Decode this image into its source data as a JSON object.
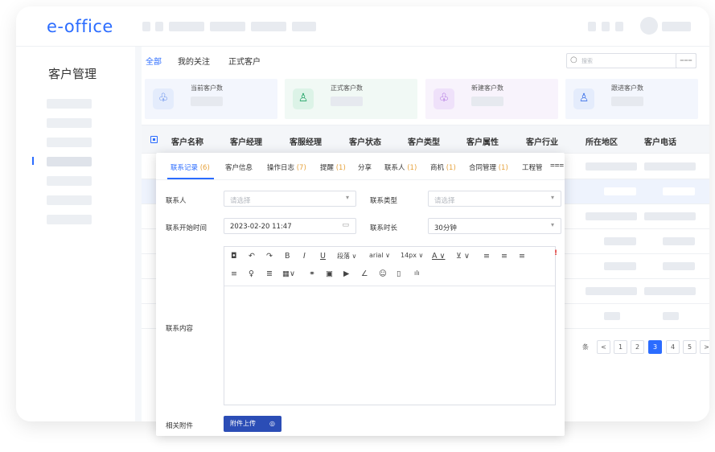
{
  "app": {
    "logo": "e-office"
  },
  "sidebar": {
    "title": "客户管理"
  },
  "tabs": [
    {
      "label": "全部",
      "active": true
    },
    {
      "label": "我的关注",
      "active": false
    },
    {
      "label": "正式客户",
      "active": false
    }
  ],
  "search": {
    "placeholder": "搜索",
    "icon": "search-icon",
    "filter_icon": "filter-icon",
    "filter_glyph": "⩶"
  },
  "cards": [
    {
      "label": "当前客户数",
      "icon": "customers-icon",
      "glyph": "♧",
      "bg": "#f3f6fd",
      "icon_bg": "#e4ecfc",
      "icon_color": "#3a6fe8"
    },
    {
      "label": "正式客户数",
      "icon": "formal-customer-icon",
      "glyph": "♙",
      "bg": "#f1f9f5",
      "icon_bg": "#dcf3e7",
      "icon_color": "#21a366"
    },
    {
      "label": "新建客户数",
      "icon": "new-customer-icon",
      "glyph": "♧",
      "bg": "#f8f3fc",
      "icon_bg": "#efe1fa",
      "icon_color": "#9b4fd8"
    },
    {
      "label": "跟进客户数",
      "icon": "follow-customer-icon",
      "glyph": "♙",
      "bg": "#f3f6fd",
      "icon_bg": "#e4ecfc",
      "icon_color": "#3a6fe8"
    }
  ],
  "table": {
    "headers": [
      "客户名称",
      "客户经理",
      "客服经理",
      "客户状态",
      "客户类型",
      "客户属性",
      "客户行业",
      "所在地区",
      "客户电话"
    ]
  },
  "pagination": {
    "prefix": "条",
    "pages": [
      "1",
      "2",
      "3",
      "4",
      "5"
    ],
    "active": "3",
    "prev": "<",
    "next": ">"
  },
  "modal": {
    "tabs": [
      {
        "label": "联系记录",
        "count": "(6)",
        "active": true
      },
      {
        "label": "客户信息",
        "count": "",
        "active": false
      },
      {
        "label": "操作日志",
        "count": "(7)",
        "active": false
      },
      {
        "label": "提醒",
        "count": "(1)",
        "active": false
      },
      {
        "label": "分享",
        "count": "",
        "active": false
      },
      {
        "label": "联系人",
        "count": "(1)",
        "active": false
      },
      {
        "label": "商机",
        "count": "(1)",
        "active": false
      },
      {
        "label": "合同管理",
        "count": "(1)",
        "active": false
      },
      {
        "label": "工程管",
        "count": "",
        "active": false
      }
    ],
    "more_glyph": "⩶",
    "form": {
      "contact_label": "联系人",
      "contact_placeholder": "请选择",
      "contact_type_label": "联系类型",
      "contact_type_placeholder": "请选择",
      "start_time_label": "联系开始时间",
      "start_time_value": "2023-02-20 11:47",
      "duration_label": "联系时长",
      "duration_value": "30分钟",
      "content_label": "联系内容",
      "attachment_label": "相关附件",
      "upload_button": "附件上传",
      "dropdown_arrow": "▾",
      "calendar_glyph": "▭"
    },
    "toolbar_row1": [
      {
        "icon": "source-icon",
        "glyph": "◘"
      },
      {
        "icon": "undo-icon",
        "glyph": "↶"
      },
      {
        "icon": "redo-icon",
        "glyph": "↷"
      },
      {
        "icon": "bold-icon",
        "glyph": "B"
      },
      {
        "icon": "italic-icon",
        "glyph": "I"
      },
      {
        "icon": "underline-icon",
        "glyph": "U"
      },
      {
        "icon": "paragraph-select",
        "glyph": "段落 ∨"
      },
      {
        "icon": "font-family-select",
        "glyph": "arial ∨"
      },
      {
        "icon": "font-size-select",
        "glyph": "14px ∨"
      },
      {
        "icon": "font-color-icon",
        "glyph": "A ∨"
      },
      {
        "icon": "highlight-icon",
        "glyph": "⊻ ∨"
      },
      {
        "icon": "align-left-icon",
        "glyph": "≡"
      },
      {
        "icon": "align-center-icon",
        "glyph": "≡"
      },
      {
        "icon": "align-right-icon",
        "glyph": "≡"
      }
    ],
    "toolbar_warning": "!",
    "toolbar_row2": [
      {
        "icon": "justify-icon",
        "glyph": "≡"
      },
      {
        "icon": "format-painter-icon",
        "glyph": "♀"
      },
      {
        "icon": "list-icon",
        "glyph": "≣"
      },
      {
        "icon": "table-icon",
        "glyph": "▦∨"
      },
      {
        "icon": "link-icon",
        "glyph": "⚭"
      },
      {
        "icon": "image-icon",
        "glyph": "▣"
      },
      {
        "icon": "video-icon",
        "glyph": "▶"
      },
      {
        "icon": "pen-icon",
        "glyph": "∠"
      },
      {
        "icon": "emoji-icon",
        "glyph": "☺"
      },
      {
        "icon": "note-icon",
        "glyph": "▯"
      },
      {
        "icon": "chart-icon",
        "glyph": "ılı"
      }
    ],
    "attachment_icon_glyph": "◎"
  }
}
